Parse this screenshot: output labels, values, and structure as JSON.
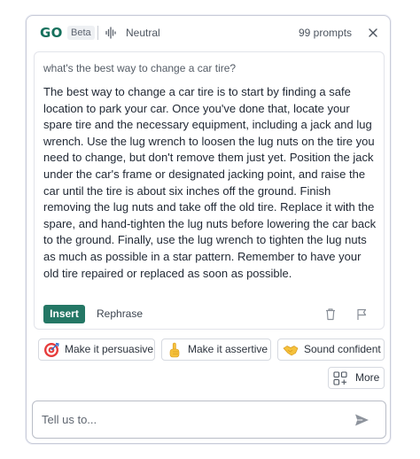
{
  "header": {
    "logo": "GO",
    "badge": "Beta",
    "tone_icon": "waveform-icon",
    "tone": "Neutral",
    "prompts": "99 prompts",
    "close_icon": "close-icon"
  },
  "card": {
    "question": "what's the best way to change a car tire?",
    "answer": "The best way to change a car tire is to start by finding a safe location to park your car. Once you've done that, locate your spare tire and the necessary equipment, including a jack and lug wrench. Use the lug wrench to loosen the lug nuts on the tire you need to change, but don't remove them just yet. Position the jack under the car's frame or designated jacking point, and raise the car until the tire is about six inches off the ground. Finish removing the lug nuts and take off the old tire. Replace it with the spare, and hand-tighten the lug nuts before lowering the car back to the ground. Finally, use the lug wrench to tighten the lug nuts as much as possible in a star pattern. Remember to have your old tire repaired or replaced as soon as possible.",
    "insert_label": "Insert",
    "rephrase_label": "Rephrase",
    "delete_icon": "trash-icon",
    "report_icon": "flag-icon"
  },
  "suggestions": [
    {
      "icon": "target-icon",
      "label": "Make it persuasive"
    },
    {
      "icon": "pointing-up-icon",
      "label": "Make it assertive"
    },
    {
      "icon": "handshake-icon",
      "label": "Sound confident"
    }
  ],
  "more": {
    "icon": "add-grid-icon",
    "label": "More"
  },
  "composer": {
    "placeholder": "Tell us to...",
    "value": "",
    "send_icon": "send-icon"
  },
  "colors": {
    "brand": "#15705c",
    "accent_button": "#247765",
    "border": "#c9ccd9"
  }
}
